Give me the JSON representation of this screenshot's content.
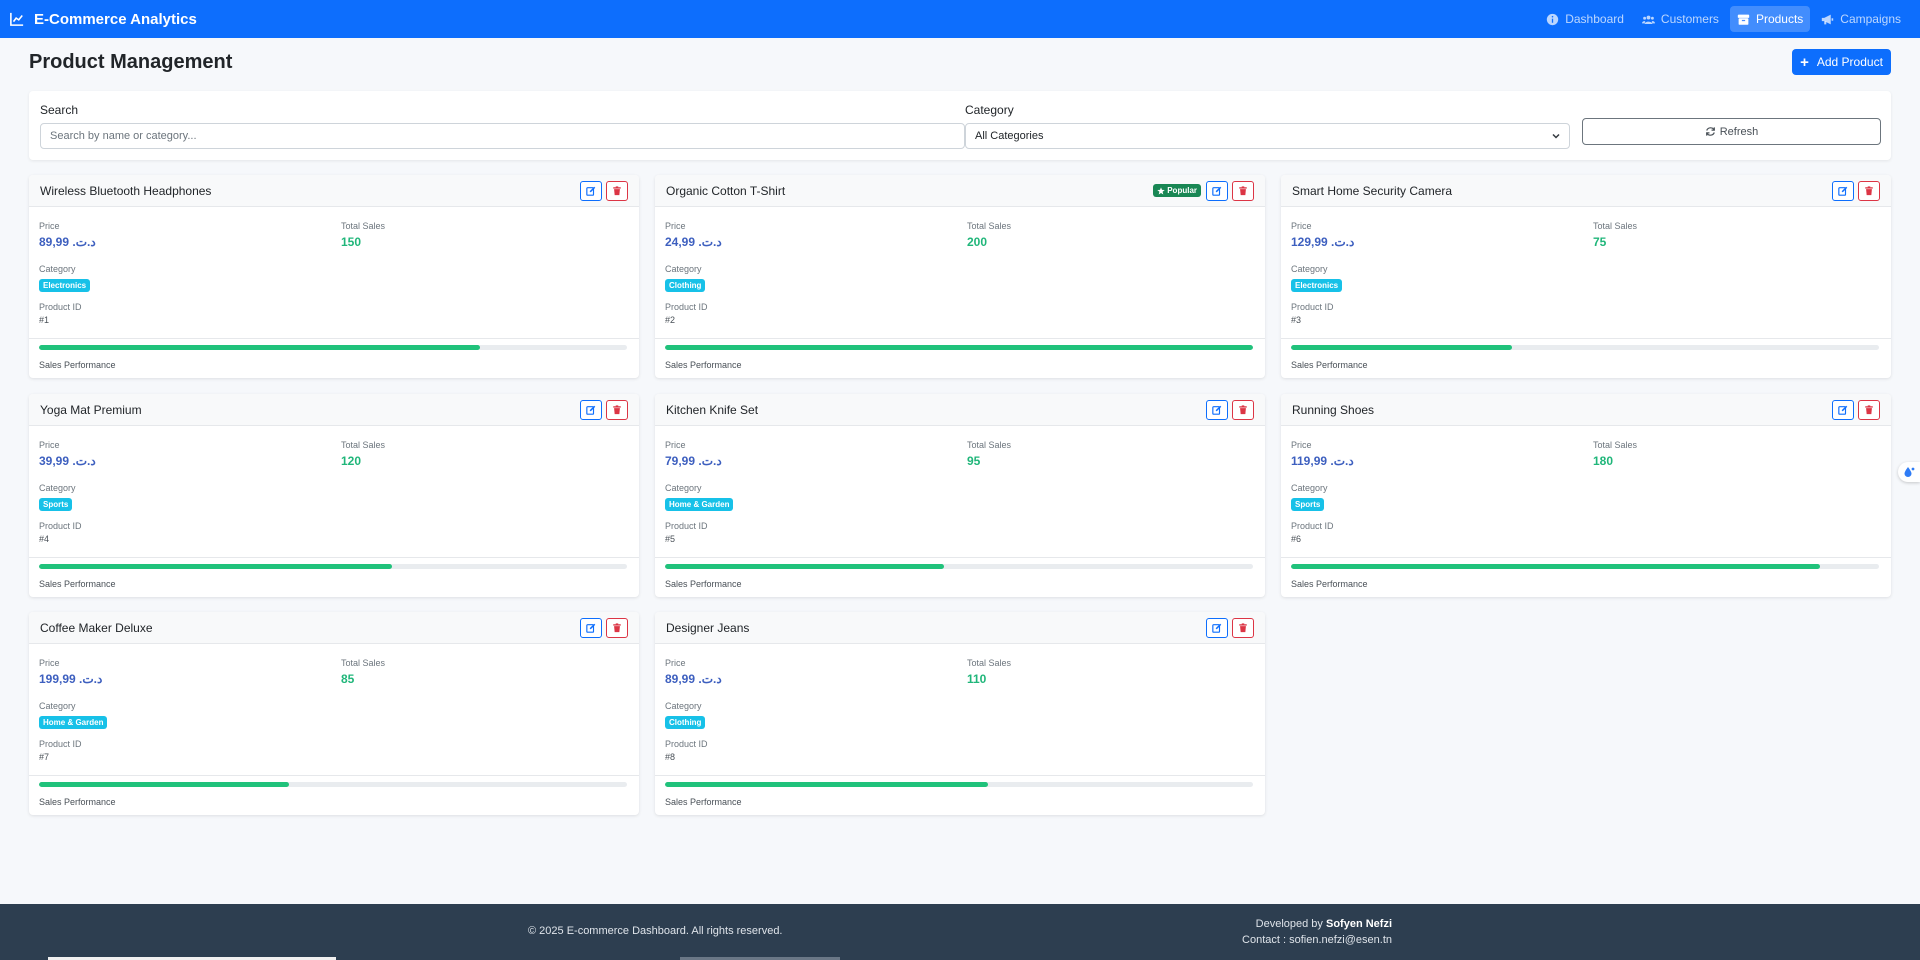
{
  "nav": {
    "brand": "E-Commerce Analytics",
    "items": [
      {
        "label": "Dashboard",
        "icon": "info-circle-icon"
      },
      {
        "label": "Customers",
        "icon": "users-icon"
      },
      {
        "label": "Products",
        "icon": "box-icon",
        "active": true
      },
      {
        "label": "Campaigns",
        "icon": "megaphone-icon"
      }
    ]
  },
  "page": {
    "title": "Product Management",
    "add_button": "Add Product"
  },
  "filters": {
    "search_label": "Search",
    "search_placeholder": "Search by name or category...",
    "category_label": "Category",
    "category_value": "All Categories",
    "refresh_label": "Refresh"
  },
  "labels": {
    "price": "Price",
    "total_sales": "Total Sales",
    "category": "Category",
    "product_id": "Product ID",
    "sales_performance": "Sales Performance",
    "popular": "Popular"
  },
  "products": [
    {
      "name": "Wireless Bluetooth Headphones",
      "price": "د.ت.‏ 89,99",
      "sales": "150",
      "category": "Electronics",
      "id": "#1",
      "performance": 0.75,
      "popular": false
    },
    {
      "name": "Organic Cotton T-Shirt",
      "price": "د.ت.‏ 24,99",
      "sales": "200",
      "category": "Clothing",
      "id": "#2",
      "performance": 1.0,
      "popular": true
    },
    {
      "name": "Smart Home Security Camera",
      "price": "د.ت.‏ 129,99",
      "sales": "75",
      "category": "Electronics",
      "id": "#3",
      "performance": 0.375,
      "popular": false
    },
    {
      "name": "Yoga Mat Premium",
      "price": "د.ت.‏ 39,99",
      "sales": "120",
      "category": "Sports",
      "id": "#4",
      "performance": 0.6,
      "popular": false
    },
    {
      "name": "Kitchen Knife Set",
      "price": "د.ت.‏ 79,99",
      "sales": "95",
      "category": "Home & Garden",
      "id": "#5",
      "performance": 0.475,
      "popular": false
    },
    {
      "name": "Running Shoes",
      "price": "د.ت.‏ 119,99",
      "sales": "180",
      "category": "Sports",
      "id": "#6",
      "performance": 0.9,
      "popular": false
    },
    {
      "name": "Coffee Maker Deluxe",
      "price": "د.ت.‏ 199,99",
      "sales": "85",
      "category": "Home & Garden",
      "id": "#7",
      "performance": 0.425,
      "popular": false
    },
    {
      "name": "Designer Jeans",
      "price": "د.ت.‏ 89,99",
      "sales": "110",
      "category": "Clothing",
      "id": "#8",
      "performance": 0.55,
      "popular": false
    }
  ],
  "footer": {
    "copyright": "© 2025 E-commerce Dashboard. All rights reserved.",
    "developed_by_prefix": "Developed by",
    "developer": "Sofyen Nefzi",
    "contact": "Contact : sofien.nefzi@esen.tn"
  },
  "colors": {
    "primary": "#0d6efd",
    "success": "#198754",
    "danger": "#dc3545",
    "info": "#17c1e8",
    "footer": "#2d3e50"
  }
}
